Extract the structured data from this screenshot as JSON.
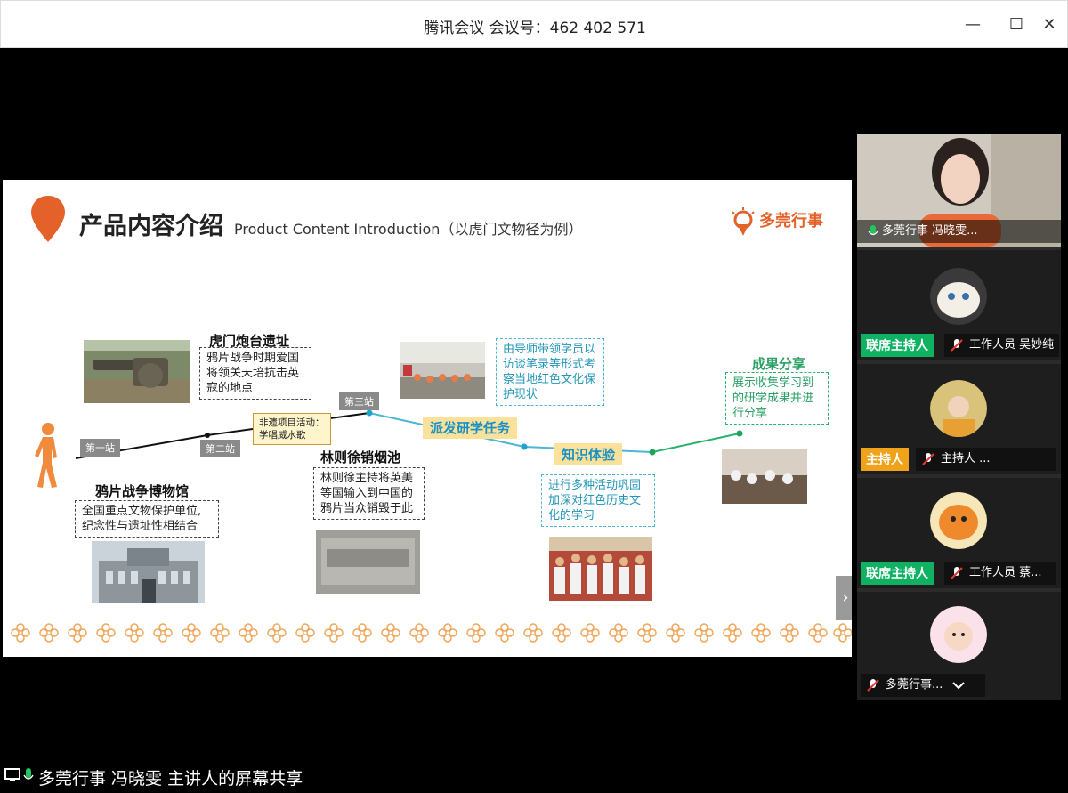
{
  "window": {
    "title": "腾讯会议 会议号：462 402 571",
    "minimize": "—",
    "maximize": "☐",
    "close": "✕"
  },
  "slide": {
    "heading": "产品内容介绍",
    "subheading": "Product Content Introduction（以虎门文物径为例）",
    "brand": "多莞行事",
    "stations": [
      "第一站",
      "第二站",
      "第三站"
    ],
    "activity": "非遗项目活动：学唱威水歌",
    "nodes": {
      "humen_fort": {
        "title": "虎门炮台遗址",
        "desc": "鸦片战争时期爱国将领关天培抗击英寇的地点"
      },
      "opium_museum": {
        "title": "鸦片战争博物馆",
        "desc": "全国重点文物保护单位,纪念性与遗址性相结合"
      },
      "linzexu_pool": {
        "title": "林则徐销烟池",
        "desc": "林则徐主持将英美等国输入到中国的鸦片当众销毁于此"
      },
      "task": {
        "tag": "派发研学任务",
        "desc": "由导师带领学员以访谈笔录等形式考察当地红色文化保护现状"
      },
      "experience": {
        "tag": "知识体验",
        "desc": "进行多种活动巩固加深对红色历史文化的学习"
      },
      "share": {
        "title": "成果分享",
        "desc": "展示收集学习到的研学成果并进行分享"
      }
    },
    "next_arrow": "›"
  },
  "participants": [
    {
      "badge": "",
      "name": "多莞行事  冯晓雯..."
    },
    {
      "badge": "联席主持人",
      "name": "工作人员 吴妙纯"
    },
    {
      "badge": "主持人",
      "name": "主持人 ..."
    },
    {
      "badge": "联席主持人",
      "name": "工作人员 蔡..."
    },
    {
      "badge": "",
      "name": "多莞行事..."
    }
  ],
  "bottom": {
    "share_text": "多莞行事  冯晓雯 主讲人的屏幕共享"
  },
  "colors": {
    "accent_orange": "#e4622a",
    "host_green": "#0fb163",
    "host_orange": "#f0a21a",
    "route_blue": "#4bb6d6",
    "route_green": "#28b36b"
  }
}
